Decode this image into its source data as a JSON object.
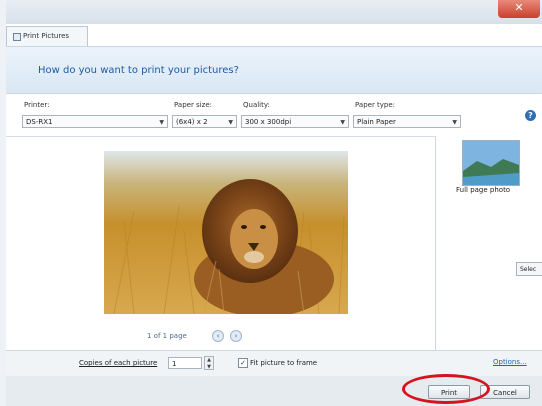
{
  "window": {
    "title": "Print Pictures",
    "close_glyph": "✕"
  },
  "header": {
    "question": "How do you want to print your pictures?"
  },
  "options": {
    "printer": {
      "label": "Printer:",
      "value": "DS-RX1"
    },
    "paper_size": {
      "label": "Paper size:",
      "value": "(6x4) x 2"
    },
    "quality": {
      "label": "Quality:",
      "value": "300 x 300dpi"
    },
    "paper_type": {
      "label": "Paper type:",
      "value": "Plain Paper"
    },
    "help_glyph": "?"
  },
  "preview": {
    "page_indicator": "1 of 1 page",
    "prev_glyph": "‹",
    "next_glyph": "›"
  },
  "layouts": {
    "items": [
      {
        "label": "Full page photo"
      }
    ],
    "side_tab_label": "Selec"
  },
  "bottom": {
    "copies_label": "Copies of each picture",
    "copies_value": "1",
    "fit_label": "Fit picture to frame",
    "fit_checked": "✓",
    "options_link": "Options..."
  },
  "footer": {
    "print_label": "Print",
    "cancel_label": "Cancel"
  },
  "colors": {
    "accent": "#1f5aa0",
    "highlight_ring": "#d4141e",
    "close_button": "#c9402c"
  }
}
